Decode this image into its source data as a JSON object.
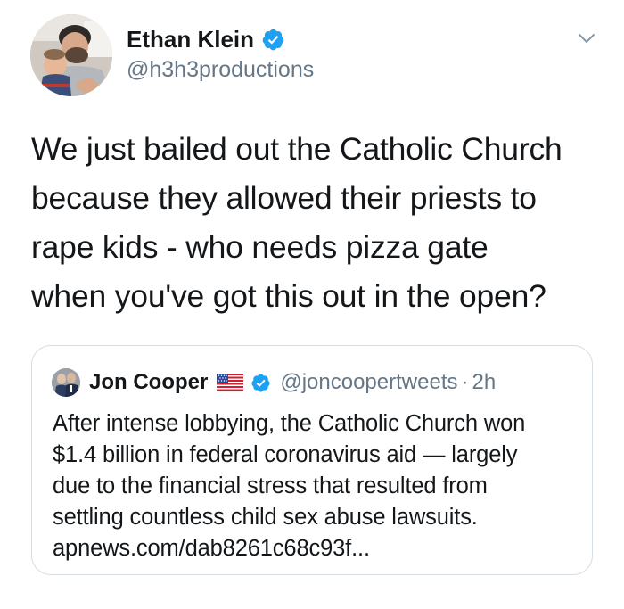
{
  "tweet": {
    "author": {
      "display_name": "Ethan Klein",
      "handle": "@h3h3productions",
      "verified": true,
      "avatar_icon": "profile-photo-avatar"
    },
    "text": "We just bailed out the Catholic Church\nbecause they allowed their priests to\nrape kids - who needs pizza gate\nwhen you've got this out in the open?",
    "menu_icon": "chevron-down-icon"
  },
  "quoted_tweet": {
    "author": {
      "display_name": "Jon Cooper",
      "flag_icon": "us-flag-emoji",
      "verified": true,
      "handle": "@joncoopertweets",
      "separator": "·",
      "time": "2h"
    },
    "text": "After intense lobbying, the Catholic Church won\n$1.4 billion in federal coronavirus aid — largely\ndue to the financial stress that resulted from\nsettling countless child sex abuse lawsuits.\napnews.com/dab8261c68c93f..."
  },
  "colors": {
    "text_primary": "#14171a",
    "text_secondary": "#657786",
    "verified_blue": "#1da1f2",
    "card_border": "#d4dde3",
    "background": "#ffffff"
  }
}
